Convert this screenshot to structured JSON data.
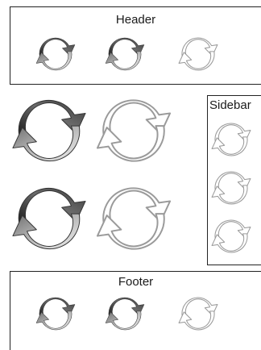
{
  "header": {
    "title": "Header",
    "icons": [
      "refresh-gradient-icon",
      "refresh-gradient-icon",
      "refresh-outline-icon"
    ]
  },
  "main": {
    "icons": [
      "refresh-gradient-icon",
      "refresh-outline-icon",
      "refresh-gradient-icon",
      "refresh-outline-icon"
    ]
  },
  "sidebar": {
    "title": "Sidebar",
    "icons": [
      "refresh-outline-icon",
      "refresh-outline-icon",
      "refresh-outline-icon"
    ]
  },
  "footer": {
    "title": "Footer",
    "icons": [
      "refresh-gradient-icon",
      "refresh-gradient-icon",
      "refresh-outline-icon"
    ]
  },
  "colors": {
    "border": "#222222",
    "icon_dark": "#2b2b2b",
    "icon_light": "#d6d6d6",
    "outline": "#9a9a9a"
  }
}
